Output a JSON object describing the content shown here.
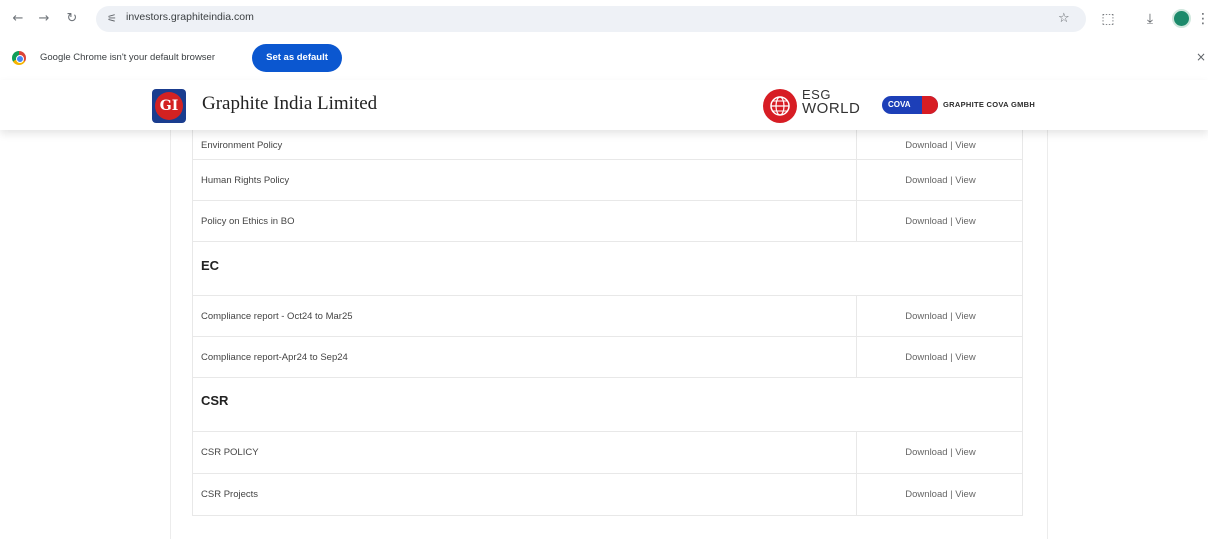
{
  "browser": {
    "url": "investors.graphiteindia.com",
    "nav": {
      "back": "←",
      "forward": "→",
      "reload": "↻"
    },
    "icons": [
      "site-info-icon",
      "bookmark-star-icon",
      "extensions-icon",
      "download-icon",
      "profile-avatar",
      "menu-icon"
    ]
  },
  "infobar": {
    "message": "Google Chrome isn't your default browser",
    "button": "Set as default",
    "close": "×"
  },
  "header": {
    "logo_text": "GI",
    "brand": "Graphite India Limited",
    "esg_line1": "ESG",
    "esg_line2": "WORLD",
    "cova_badge": "COVA",
    "cova_text": "GRAPHITE COVA GMBH"
  },
  "table": {
    "rows_top": [
      {
        "label": "Environment Policy",
        "action": "Download | View"
      },
      {
        "label": "Human Rights Policy",
        "action": "Download | View"
      },
      {
        "label": "Policy on Ethics in BO",
        "action": "Download | View"
      }
    ],
    "section_ec": "EC",
    "rows_ec": [
      {
        "label": "Compliance report - Oct24 to Mar25",
        "action": "Download | View"
      },
      {
        "label": "Compliance report-Apr24 to Sep24",
        "action": "Download | View"
      }
    ],
    "section_csr": "CSR",
    "rows_csr": [
      {
        "label": "CSR POLICY",
        "action": "Download | View"
      },
      {
        "label": "CSR Projects",
        "action": "Download | View"
      }
    ]
  },
  "colors": {
    "accent_blue": "#0b57d0",
    "brand_red": "#d32222",
    "brand_navy": "#1a3d8f"
  }
}
